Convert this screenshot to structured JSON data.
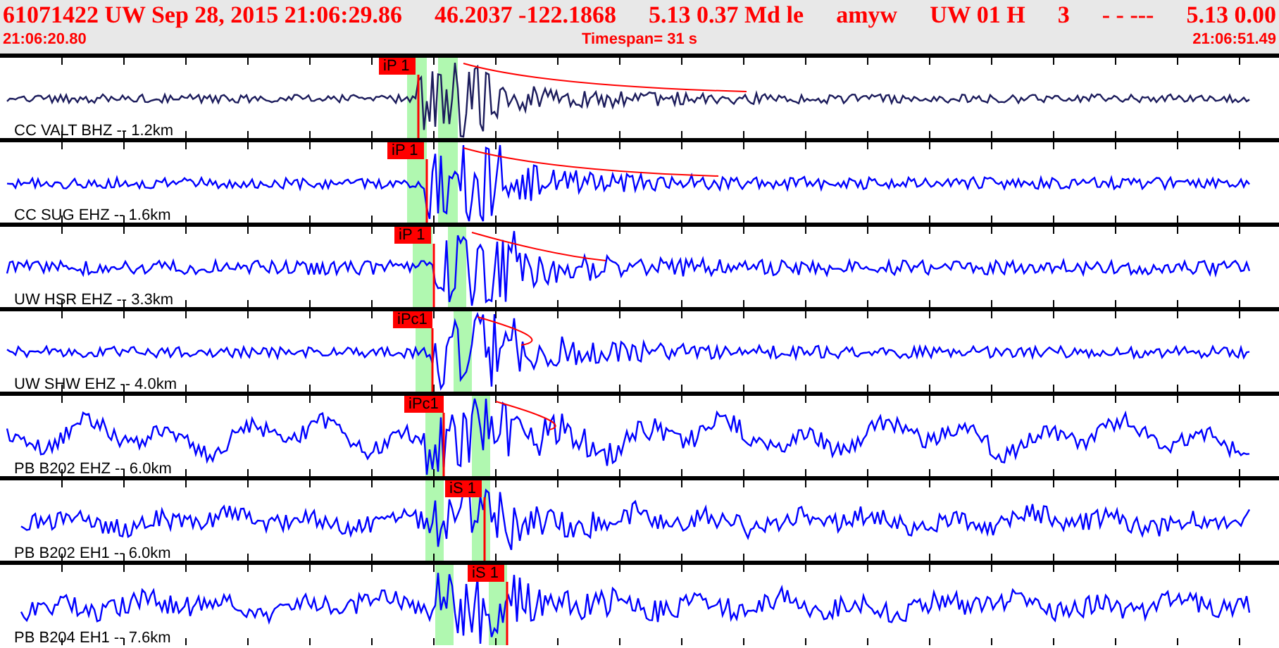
{
  "header": {
    "fields": [
      "61071422 UW Sep 28, 2015 21:06:29.86",
      "46.2037 -122.1868",
      "5.13 0.37 Md le",
      "amyw",
      "UW 01 H",
      "3",
      "- - ---",
      "5.13 0.00"
    ],
    "start_time": "21:06:20.80",
    "timespan": "Timespan= 31 s",
    "end_time": "21:06:51.49"
  },
  "traces": [
    {
      "label": "CC VALT BHZ -- 1.2km",
      "color": "#1c1c5c",
      "pick": "iP 1"
    },
    {
      "label": "CC SUG EHZ -- 1.6km",
      "color": "#0000ff",
      "pick": "iP 1"
    },
    {
      "label": "UW HSR EHZ -- 3.3km",
      "color": "#0000ff",
      "pick": "iP 1"
    },
    {
      "label": "UW SHW EHZ -- 4.0km",
      "color": "#0000ff",
      "pick": "iPc1"
    },
    {
      "label": "PB B202 EHZ -- 6.0km",
      "color": "#0000ff",
      "pick": "iPc1"
    },
    {
      "label": "PB B202 EH1 -- 6.0km",
      "color": "#0000ff",
      "pick": "iS 1"
    },
    {
      "label": "PB B204 EH1 -- 7.6km",
      "color": "#0000ff",
      "pick": "iS 1"
    }
  ]
}
